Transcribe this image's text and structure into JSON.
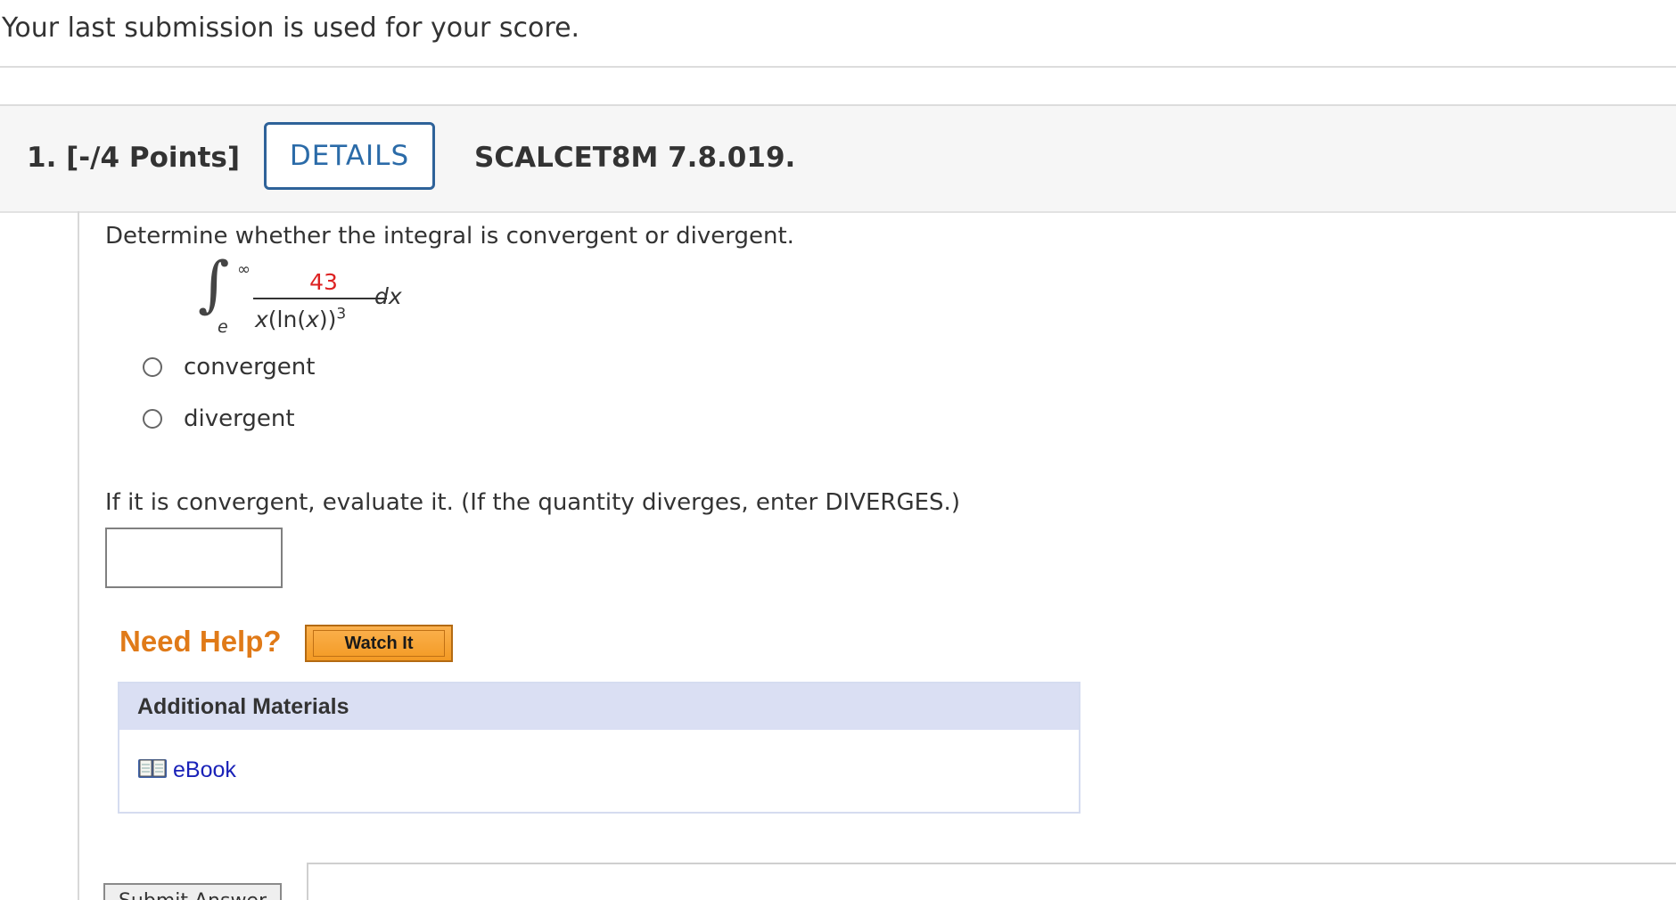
{
  "notice": "Your last submission is used for your score.",
  "question": {
    "points": "1.  [-/4 Points]",
    "details_label": "DETAILS",
    "code": "SCALCET8M 7.8.019.",
    "prompt": "Determine whether the integral is convergent or divergent.",
    "integral": {
      "upper": "∞",
      "lower": "e",
      "numerator": "43",
      "denominator_x": "x",
      "denominator_ln": "(ln(",
      "denominator_x2": "x",
      "denominator_close": "))",
      "exponent": "3",
      "dx": "dx"
    },
    "options": [
      "convergent",
      "divergent"
    ],
    "prompt2": "If it is convergent, evaluate it. (If the quantity diverges, enter DIVERGES.)",
    "answer_value": ""
  },
  "help": {
    "need_help": "Need Help?",
    "watch_it": "Watch It"
  },
  "materials": {
    "header": "Additional Materials",
    "ebook": "eBook"
  },
  "submit_label": "Submit Answer",
  "colors": {
    "accent_blue": "#2b6ba8",
    "numerator_red": "#dd2222",
    "need_help_orange": "#e07a18",
    "watch_button": "#f7a83a",
    "materials_header_bg": "#dadff3",
    "link_blue": "#1a22b8"
  },
  "icons": {
    "ebook": "book-icon"
  }
}
